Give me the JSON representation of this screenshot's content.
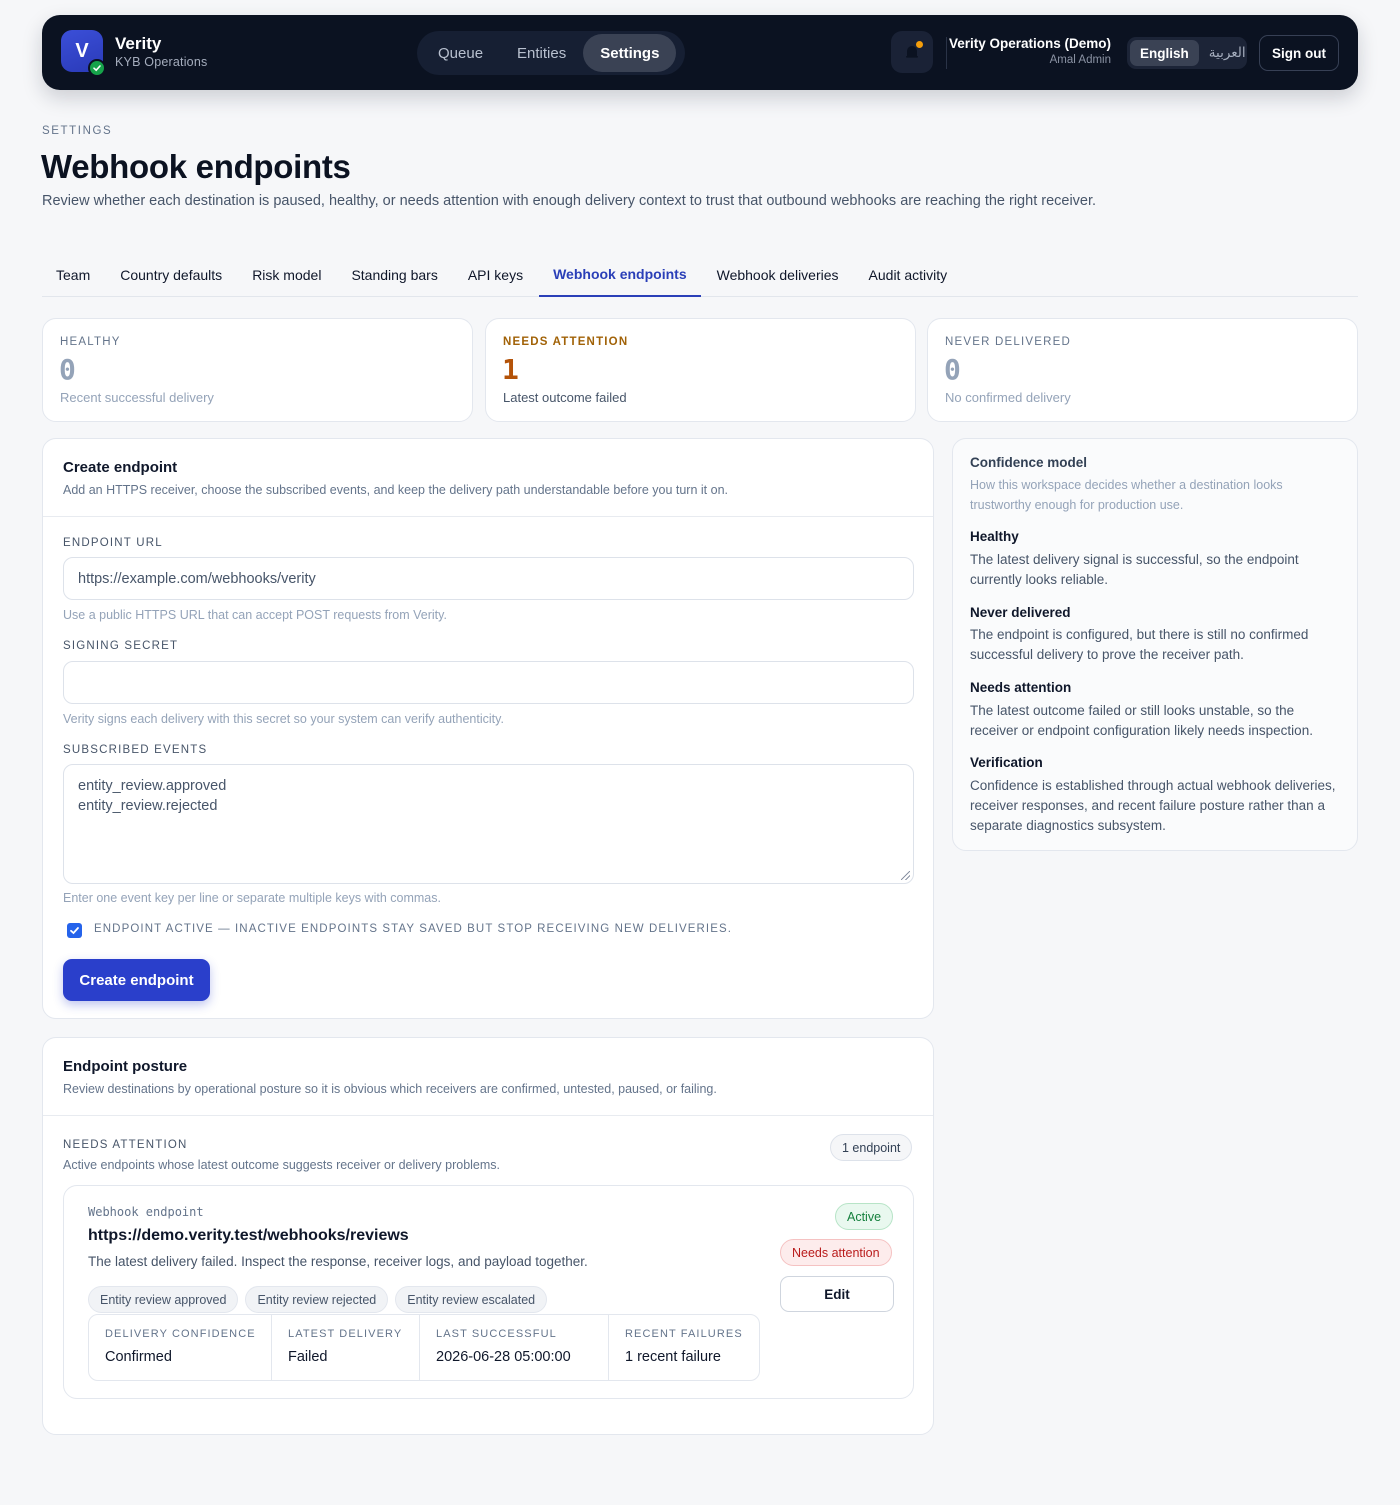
{
  "app": {
    "name": "Verity",
    "logo_letter": "V",
    "subtitle": "KYB Operations",
    "nav": [
      "Queue",
      "Entities",
      "Settings"
    ],
    "org_name": "Verity Operations (Demo)",
    "user_name": "Amal Admin",
    "languages": [
      "English",
      "العربية"
    ],
    "sign_out": "Sign out"
  },
  "header": {
    "eyebrow": "SETTINGS",
    "title": "Webhook endpoints",
    "description": "Review whether each destination is paused, healthy, or needs attention with enough delivery context to trust that outbound webhooks are reaching the right receiver."
  },
  "tabs": [
    "Team",
    "Country defaults",
    "Risk model",
    "Standing bars",
    "API keys",
    "Webhook endpoints",
    "Webhook deliveries",
    "Audit activity"
  ],
  "stats": [
    {
      "label": "HEALTHY",
      "value": "0",
      "sub": "Recent successful delivery"
    },
    {
      "label": "NEEDS ATTENTION",
      "value": "1",
      "sub": "Latest outcome failed"
    },
    {
      "label": "NEVER DELIVERED",
      "value": "0",
      "sub": "No confirmed delivery"
    }
  ],
  "create": {
    "title": "Create endpoint",
    "sub": "Add an HTTPS receiver, choose the subscribed events, and keep the delivery path understandable before you turn it on.",
    "url_label": "ENDPOINT URL",
    "url_placeholder": "https://example.com/webhooks/verity",
    "url_help": "Use a public HTTPS URL that can accept POST requests from Verity.",
    "secret_label": "SIGNING SECRET",
    "secret_value": "",
    "secret_help": "Verity signs each delivery with this secret so your system can verify authenticity.",
    "events_label": "SUBSCRIBED EVENTS",
    "events_line1": "entity_review.approved",
    "events_line2": "entity_review.rejected",
    "events_help": "Enter one event key per line or separate multiple keys with commas.",
    "active_label": "ENDPOINT ACTIVE — INACTIVE ENDPOINTS STAY SAVED BUT STOP RECEIVING NEW DELIVERIES.",
    "submit": "Create endpoint"
  },
  "confidence": {
    "title": "Confidence model",
    "sub": "How this workspace decides whether a destination looks trustworthy enough for production use.",
    "items": [
      {
        "h": "Healthy",
        "p": "The latest delivery signal is successful, so the endpoint currently looks reliable."
      },
      {
        "h": "Never delivered",
        "p": "The endpoint is configured, but there is still no confirmed successful delivery to prove the receiver path."
      },
      {
        "h": "Needs attention",
        "p": "The latest outcome failed or still looks unstable, so the receiver or endpoint configuration likely needs inspection."
      },
      {
        "h": "Verification",
        "p": "Confidence is established through actual webhook deliveries, receiver responses, and recent failure posture rather than a separate diagnostics subsystem."
      }
    ]
  },
  "posture": {
    "title": "Endpoint posture",
    "sub": "Review destinations by operational posture so it is obvious which receivers are confirmed, untested, paused, or failing.",
    "group_label": "NEEDS ATTENTION",
    "group_sub": "Active endpoints whose latest outcome suggests receiver or delivery problems.",
    "count": "1 endpoint",
    "endpoint": {
      "kind": "Webhook endpoint",
      "url": "https://demo.verity.test/webhooks/reviews",
      "desc": "The latest delivery failed. Inspect the response, receiver logs, and payload together.",
      "tags": [
        "Entity review approved",
        "Entity review rejected",
        "Entity review escalated"
      ],
      "status_active": "Active",
      "status_attention": "Needs attention",
      "edit": "Edit",
      "metrics": [
        {
          "label": "DELIVERY CONFIDENCE",
          "value": "Confirmed"
        },
        {
          "label": "LATEST DELIVERY",
          "value": "Failed"
        },
        {
          "label": "LAST SUCCESSFUL",
          "value": "2026-06-28 05:00:00"
        },
        {
          "label": "RECENT FAILURES",
          "value": "1 recent failure"
        }
      ]
    }
  },
  "colors": {
    "topbar": "#0b1221",
    "accent": "#2a3fcb",
    "warning": "#b45309",
    "success": "#15803d",
    "danger": "#b91c1c"
  }
}
